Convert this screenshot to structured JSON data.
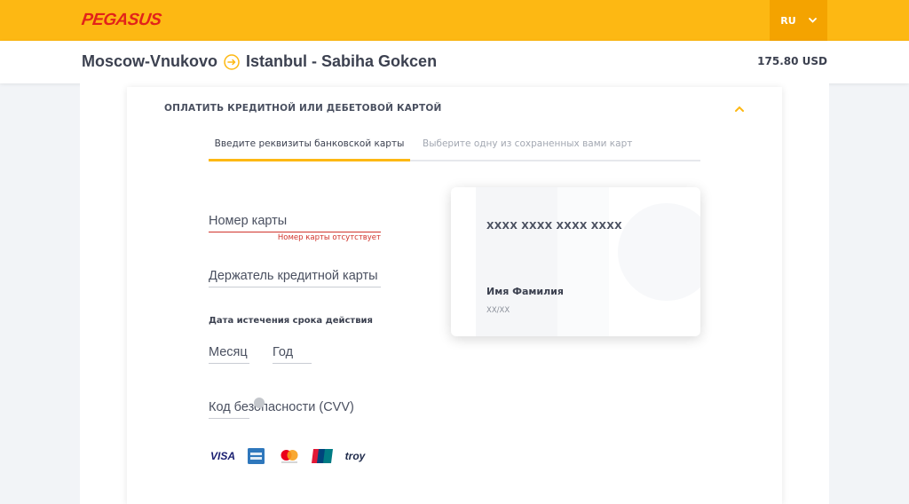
{
  "header": {
    "logo_text": "PEGASUS",
    "language": "RU",
    "brand_color": "#fdb813",
    "logo_color": "#e2231a"
  },
  "route": {
    "origin": "Moscow-Vnukovo",
    "destination": "Istanbul - Sabiha Gokcen",
    "price": "175.80 USD"
  },
  "payment": {
    "section_title": "ОПЛАТИТЬ КРЕДИТНОЙ ИЛИ ДЕБЕТОВОЙ КАРТОЙ",
    "tabs": [
      {
        "label": "Введите реквизиты банковской карты",
        "active": true
      },
      {
        "label": "Выберите одну из сохраненных вами карт",
        "active": false
      }
    ],
    "fields": {
      "card_number_placeholder": "Номер карты",
      "card_number_error": "Номер карты отсутствует",
      "card_holder_placeholder": "Держатель кредитной карты",
      "expiry_label": "Дата истечения срока действия",
      "month_placeholder": "Месяц",
      "year_placeholder": "Год",
      "cvv_placeholder": "Код безопасности (CVV)"
    },
    "card_brands": [
      "VISA",
      "american-express-icon",
      "mastercard-icon",
      "unionpay-icon",
      "troy"
    ],
    "error_color": "#d0342c"
  },
  "card_preview": {
    "number": "XXXX XXXX XXXX XXXX",
    "holder": "Имя Фамилия",
    "expiry": "XX/XX"
  }
}
